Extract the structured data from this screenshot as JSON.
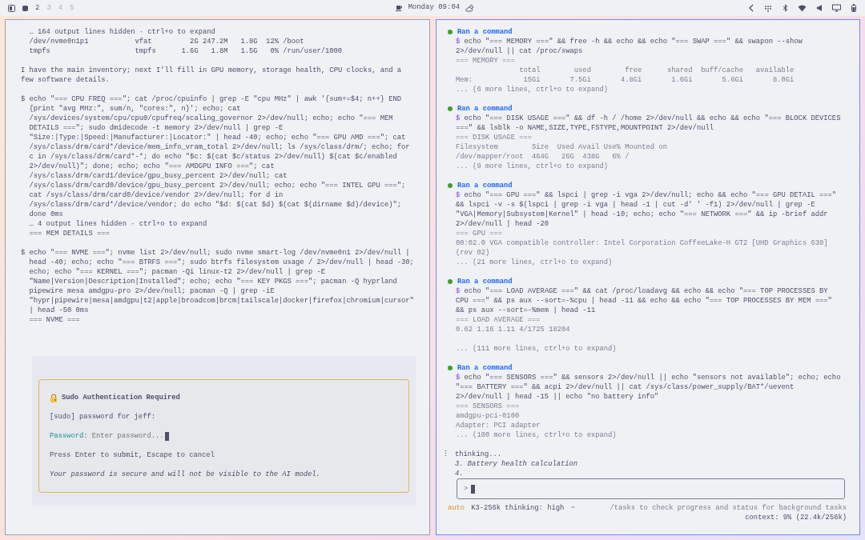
{
  "topbar": {
    "workspaces": [
      {
        "kind": "dot",
        "selected": true
      },
      {
        "kind": "number",
        "label": "2",
        "selected": false,
        "occupied": true
      },
      {
        "kind": "number",
        "label": "3",
        "selected": false,
        "occupied": false
      },
      {
        "kind": "number",
        "label": "4",
        "selected": false,
        "occupied": false
      },
      {
        "kind": "number",
        "label": "5",
        "selected": false,
        "occupied": false
      }
    ],
    "clock": "Monday 09:04"
  },
  "left_pane": {
    "blocks": [
      {
        "kind": "output",
        "lines": [
          "… 164 output lines hidden · ctrl+o to expand",
          "/dev/nvme0n1p1           vfat         2G 247.2M   1.8G  12% /boot",
          "tmpfs                    tmpfs      1.6G   1.8M   1.5G   0% /run/user/1000"
        ]
      },
      {
        "kind": "message",
        "lines": [
          "I have the main inventory; next I’ll fill in GPU memory, storage health, CPU clocks, and a",
          "few software details."
        ]
      },
      {
        "kind": "command",
        "prompt": "$",
        "lines": [
          "echo \"=== CPU FREQ ===\"; cat /proc/cpuinfo | grep -E \"cpu MHz\" | awk '{sum+=$4; n++} END",
          "{print \"avg MHz:\", sum/n, \"cores:\", n}'; echo; cat",
          "/sys/devices/system/cpu/cpu0/cpufreq/scaling_governor 2>/dev/null; echo; echo \"=== MEM",
          "DETAILS ===\"; sudo dmidecode -t memory 2>/dev/null | grep -E",
          "\"Size:|Type:|Speed:|Manufacturer:|Locator:\" | head -40; echo; echo \"=== GPU AMD ===\"; cat",
          "/sys/class/drm/card*/device/mem_info_vram_total 2>/dev/null; ls /sys/class/drm/; echo; for",
          "c in /sys/class/drm/card*-*; do echo \"$c: $(cat $c/status 2>/dev/null) $(cat $c/enabled",
          "2>/dev/null)\"; done; echo; echo \"=== AMDGPU INFO ===\"; cat",
          "/sys/class/drm/card1/device/gpu_busy_percent 2>/dev/null; cat",
          "/sys/class/drm/card0/device/gpu_busy_percent 2>/dev/null; echo; echo \"=== INTEL GPU ===\";",
          "cat /sys/class/drm/card0/device/vendor 2>/dev/null; for d in",
          "/sys/class/drm/card*/device/vendor; do echo \"$d: $(cat $d) $(cat $(dirname $d)/device)\";",
          "done 0ms"
        ],
        "output": [
          "… 4 output lines hidden · ctrl+o to expand",
          "=== MEM DETAILS ==="
        ]
      },
      {
        "kind": "command",
        "prompt": "$",
        "lines": [
          "echo \"=== NVME ===\"; nvme list 2>/dev/null; sudo nvme smart-log /dev/nvme0n1 2>/dev/null |",
          "head -40; echo; echo \"=== BTRFS ===\"; sudo btrfs filesystem usage / 2>/dev/null | head -30;",
          "echo; echo \"=== KERNEL ===\"; pacman -Qi linux-t2 2>/dev/null | grep -E",
          "\"Name|Version|Description|Installed\"; echo; echo \"=== KEY PKGS ===\"; pacman -Q hyprland",
          "pipewire mesa amdgpu-pro 2>/dev/null; pacman -Q | grep -iE",
          "\"hypr|pipewire|mesa|amdgpu|t2|apple|broadcom|brcm|tailscale|docker|firefox|chromium|cursor\"",
          "| head -50 0ms"
        ],
        "output": [
          "=== NVME ==="
        ]
      }
    ],
    "sudo_dialog": {
      "title": "Sudo Authentication Required",
      "prompt": "[sudo] password for jeff:",
      "field_label": "Password:",
      "placeholder": "Enter password...",
      "hint": "Press Enter to submit, Escape to cancel",
      "note": "Your password is secure and will not be visible to the AI model."
    }
  },
  "right_pane": {
    "entries": [
      {
        "title": "Ran a command",
        "prompt": "$",
        "command": [
          "echo \"=== MEMORY ===\" && free -h && echo && echo \"=== SWAP ===\" && swapon --show",
          "2>/dev/null || cat /proc/swaps"
        ],
        "output": [
          [
            "=== MEMORY ===",
            "               total        used        free      shared  buff/cache   available",
            "Mem:            15Gi       7.5Gi       4.8Gi       1.6Gi       5.6Gi       8.0Gi",
            "... (6 more lines, ctrl+o to expand)"
          ]
        ]
      },
      {
        "title": "Ran a command",
        "prompt": "$",
        "command": [
          "echo \"=== DISK USAGE ===\" && df -h / /home 2>/dev/null && echo && echo \"=== BLOCK DEVICES",
          "===\" && lsblk -o NAME,SIZE,TYPE,FSTYPE,MOUNTPOINT 2>/dev/null"
        ],
        "output": [
          [
            "=== DISK USAGE ===",
            "Filesystem        Size  Used Avail Use% Mounted on",
            "/dev/mapper/root  464G   26G  438G   6% /",
            "... (9 more lines, ctrl+o to expand)"
          ]
        ]
      },
      {
        "title": "Ran a command",
        "prompt": "$",
        "command": [
          "echo \"=== GPU ===\" && lspci | grep -i vga 2>/dev/null; echo && echo \"=== GPU DETAIL ===\"",
          "&& lspci -v -s $(lspci | grep -i vga | head -1 | cut -d' ' -f1) 2>/dev/null | grep -E",
          "\"VGA|Memory|Subsystem|Kernel\" | head -10; echo; echo \"=== NETWORK ===\" && ip -brief addr",
          "2>/dev/null | head -20"
        ],
        "output": [
          [
            "=== GPU ===",
            "00:02.0 VGA compatible controller: Intel Corporation CoffeeLake-H GT2 [UHD Graphics 630]",
            "(rev 02)",
            "... (21 more lines, ctrl+o to expand)"
          ]
        ]
      },
      {
        "title": "Ran a command",
        "prompt": "$",
        "command": [
          "echo \"=== LOAD AVERAGE ===\" && cat /proc/loadavg && echo && echo \"=== TOP PROCESSES BY",
          "CPU ===\" && ps aux --sort=-%cpu | head -11 && echo && echo \"=== TOP PROCESSES BY MEM ===\"",
          "&& ps aux --sort=-%mem | head -11"
        ],
        "output": [
          [
            "=== LOAD AVERAGE ===",
            "0.62 1.16 1.11 4/1725 18204"
          ],
          [
            "... (111 more lines, ctrl+o to expand)"
          ]
        ]
      },
      {
        "title": "Ran a command",
        "prompt": "$",
        "command": [
          "echo \"=== SENSORS ===\" && sensors 2>/dev/null || echo \"sensors not available\"; echo; echo",
          "\"=== BATTERY ===\" && acpi 2>/dev/null || cat /sys/class/power_supply/BAT*/uevent",
          "2>/dev/null | head -15 || echo \"no battery info\""
        ],
        "output": [
          [
            "=== SENSORS ===",
            "amdgpu-pci-0100",
            "Adapter: PCI adapter",
            "... (100 more lines, ctrl+o to expand)"
          ]
        ]
      }
    ],
    "thinking": {
      "label": "thinking...",
      "lines": [
        "3. Battery health calculation",
        "4."
      ]
    },
    "input": {
      "prompt": ">"
    },
    "status": {
      "mode": "auto",
      "model": "K3-256k thinking: high",
      "cwd": "~",
      "hint": "/tasks to check progress and status for background tasks",
      "context": "context: 9% (22.4k/256k)"
    }
  }
}
